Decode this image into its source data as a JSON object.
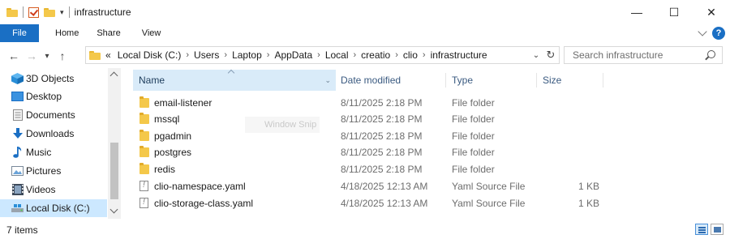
{
  "window": {
    "title": "infrastructure",
    "controls": {
      "minimize": "—",
      "maximize": "☐",
      "close": "✕"
    }
  },
  "ribbon": {
    "tabs": [
      "File",
      "Home",
      "Share",
      "View"
    ],
    "help_glyph": "?"
  },
  "address": {
    "prefix": "«",
    "crumbs": [
      "Local Disk (C:)",
      "Users",
      "Laptop",
      "AppData",
      "Local",
      "creatio",
      "clio",
      "infrastructure"
    ],
    "separator": "›"
  },
  "search": {
    "placeholder": "Search infrastructure"
  },
  "nav": {
    "items": [
      {
        "label": "3D Objects",
        "icon": "cube-icon",
        "selected": false
      },
      {
        "label": "Desktop",
        "icon": "desktop-icon",
        "selected": false
      },
      {
        "label": "Documents",
        "icon": "documents-icon",
        "selected": false
      },
      {
        "label": "Downloads",
        "icon": "download-icon",
        "selected": false
      },
      {
        "label": "Music",
        "icon": "music-icon",
        "selected": false
      },
      {
        "label": "Pictures",
        "icon": "pictures-icon",
        "selected": false
      },
      {
        "label": "Videos",
        "icon": "videos-icon",
        "selected": false
      },
      {
        "label": "Local Disk (C:)",
        "icon": "drive-icon",
        "selected": true
      }
    ]
  },
  "columns": {
    "name": "Name",
    "date": "Date modified",
    "type": "Type",
    "size": "Size"
  },
  "files": [
    {
      "name": "email-listener",
      "date": "8/11/2025 2:18 PM",
      "type": "File folder",
      "size": "",
      "kind": "folder"
    },
    {
      "name": "mssql",
      "date": "8/11/2025 2:18 PM",
      "type": "File folder",
      "size": "",
      "kind": "folder"
    },
    {
      "name": "pgadmin",
      "date": "8/11/2025 2:18 PM",
      "type": "File folder",
      "size": "",
      "kind": "folder"
    },
    {
      "name": "postgres",
      "date": "8/11/2025 2:18 PM",
      "type": "File folder",
      "size": "",
      "kind": "folder"
    },
    {
      "name": "redis",
      "date": "8/11/2025 2:18 PM",
      "type": "File folder",
      "size": "",
      "kind": "folder"
    },
    {
      "name": "clio-namespace.yaml",
      "date": "4/18/2025 12:13 AM",
      "type": "Yaml Source File",
      "size": "1 KB",
      "kind": "doc"
    },
    {
      "name": "clio-storage-class.yaml",
      "date": "4/18/2025 12:13 AM",
      "type": "Yaml Source File",
      "size": "1 KB",
      "kind": "doc"
    }
  ],
  "ghost_label": "Window Snip",
  "status": {
    "count": "7 items"
  },
  "colors": {
    "accent": "#1a6fc4",
    "selection": "#cce8ff",
    "folder": "#f4c84a"
  }
}
